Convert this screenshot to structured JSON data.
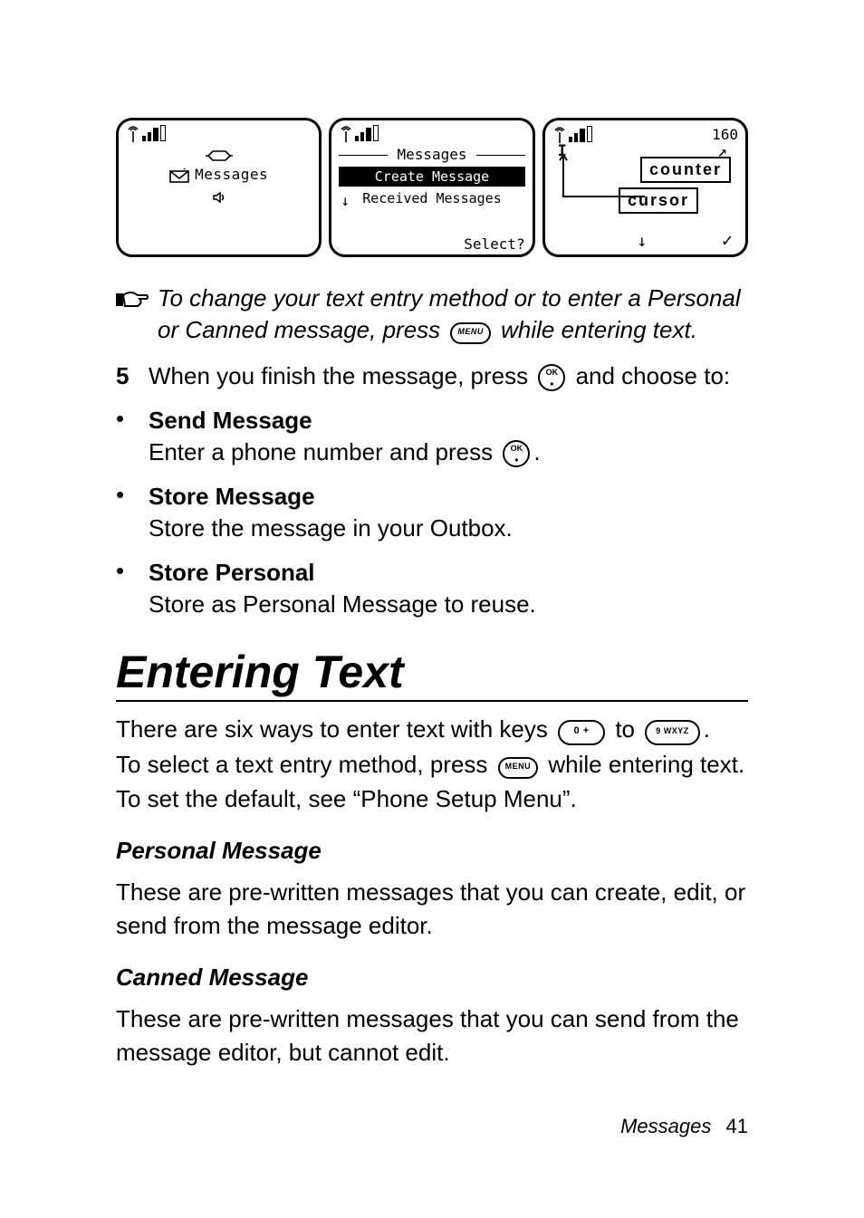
{
  "screens": {
    "s1": {
      "label": "Messages"
    },
    "s2": {
      "title": "Messages",
      "item1": "Create Message",
      "item2": "Received Messages",
      "select": "Select?"
    },
    "s3": {
      "counter_value": "160",
      "cursor_char": "I",
      "label_counter": "counter",
      "label_cursor": "cursor"
    }
  },
  "note": {
    "line": "To change your text entry method or to enter a Personal or Canned message, press",
    "tail": "while entering text."
  },
  "keys": {
    "menu": "MENU",
    "ok": "OK",
    "zero": "0 +",
    "nine": "9 WXYZ"
  },
  "step5": {
    "num": "5",
    "text_a": "When you finish the message, press",
    "text_b": "and choose to:"
  },
  "bullets": [
    {
      "head": "Send Message",
      "body_a": "Enter a phone number and press",
      "body_b": "."
    },
    {
      "head": "Store Message",
      "body": "Store the message in your Outbox."
    },
    {
      "head": "Store Personal",
      "body": "Store as Personal Message to reuse."
    }
  ],
  "section": {
    "title": "Entering Text",
    "p1_a": "There are six ways to enter text with keys",
    "p1_b": "to",
    "p1_c": ".",
    "p2_a": "To select a text entry method, press",
    "p2_b": "while entering text.",
    "p3": "To set the default, see “Phone Setup Menu”."
  },
  "sub1": {
    "title": "Personal Message",
    "body": "These are pre-written messages that you can create, edit, or send from the message editor."
  },
  "sub2": {
    "title": "Canned Message",
    "body": "These are pre-written messages that you can send from the message editor, but cannot edit."
  },
  "footer": {
    "label": "Messages",
    "page": "41"
  }
}
